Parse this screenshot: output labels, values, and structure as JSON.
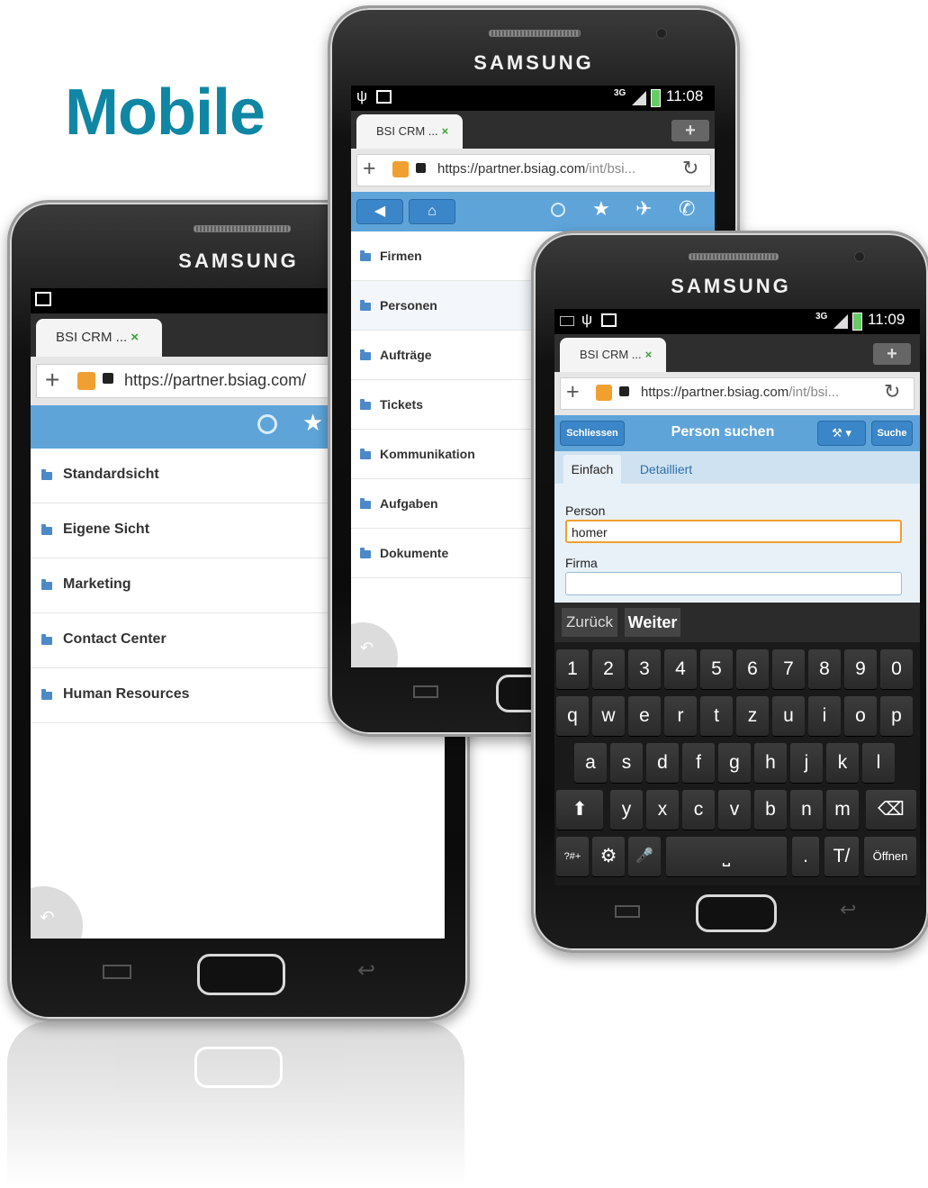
{
  "headline": "Mobile",
  "brand": "SAMSUNG",
  "browser": {
    "tab_title": "BSI CRM ...",
    "tab_close": "×",
    "url_main": "https://partner.bsiag.com/",
    "url_full_host": "https://partner.bsiag.com",
    "url_path": "/int/bsi..."
  },
  "phone_left": {
    "menu": [
      {
        "label": "Standardsicht"
      },
      {
        "label": "Eigene Sicht"
      },
      {
        "label": "Marketing"
      },
      {
        "label": "Contact Center"
      },
      {
        "label": "Human Resources"
      }
    ]
  },
  "phone_middle": {
    "status_signal": "3G",
    "time": "11:08",
    "menu": [
      {
        "label": "Firmen"
      },
      {
        "label": "Personen"
      },
      {
        "label": "Aufträge"
      },
      {
        "label": "Tickets"
      },
      {
        "label": "Kommunikation"
      },
      {
        "label": "Aufgaben"
      },
      {
        "label": "Dokumente"
      }
    ]
  },
  "phone_right": {
    "status_signal": "3G",
    "time": "11:09",
    "close_button": "Schliessen",
    "title": "Person suchen",
    "tools_button": "⚒ ▾",
    "search_button": "Suche",
    "tabs": [
      {
        "label": "Einfach"
      },
      {
        "label": "Detailliert"
      }
    ],
    "fields": [
      {
        "label": "Person",
        "value": "homer"
      },
      {
        "label": "Firma",
        "value": ""
      }
    ],
    "ime": {
      "back": "Zurück",
      "next": "Weiter"
    },
    "keyboard": {
      "row1": [
        "1",
        "2",
        "3",
        "4",
        "5",
        "6",
        "7",
        "8",
        "9",
        "0"
      ],
      "row2": [
        "q",
        "w",
        "e",
        "r",
        "t",
        "z",
        "u",
        "i",
        "o",
        "p"
      ],
      "row3": [
        "a",
        "s",
        "d",
        "f",
        "g",
        "h",
        "j",
        "k",
        "l"
      ],
      "row4": [
        "y",
        "x",
        "c",
        "v",
        "b",
        "n",
        "m"
      ],
      "symbols": "?#+",
      "dot": ".",
      "open": "Öffnen"
    }
  },
  "colors": {
    "headline": "#0f86a3",
    "toolbar": "#5ea4d9",
    "folder": "#4c89c8",
    "input_focus": "#f0a030"
  }
}
